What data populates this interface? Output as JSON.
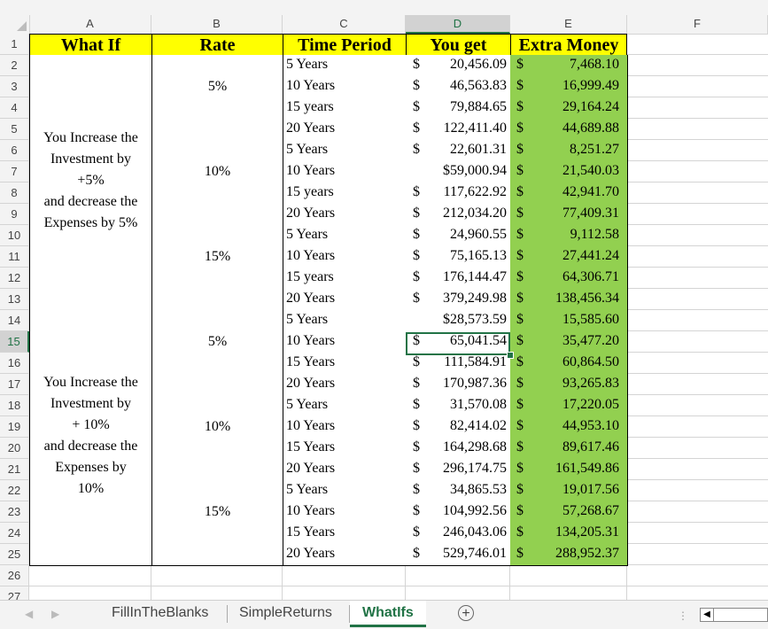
{
  "columns": [
    "A",
    "B",
    "C",
    "D",
    "E",
    "F"
  ],
  "rows": [
    "1",
    "2",
    "3",
    "4",
    "5",
    "6",
    "7",
    "8",
    "9",
    "10",
    "11",
    "12",
    "13",
    "14",
    "15",
    "16",
    "17",
    "18",
    "19",
    "20",
    "21",
    "22",
    "23",
    "24",
    "25",
    "26",
    "27"
  ],
  "selected_column": "D",
  "selected_row": "15",
  "headers": {
    "what_if": "What If",
    "rate": "Rate",
    "time_period": "Time Period",
    "you_get": "You get",
    "extra_money": "Extra Money"
  },
  "groups": [
    {
      "lines": [
        "You Increase the",
        "Investment by",
        "+5%",
        "and decrease the",
        "Expenses by 5%"
      ]
    },
    {
      "lines": [
        "You Increase the",
        "Investment by",
        "+ 10%",
        "and decrease the",
        "Expenses by",
        "10%"
      ]
    }
  ],
  "rates": [
    "5%",
    "10%",
    "15%",
    "5%",
    "10%",
    "15%"
  ],
  "data_rows": [
    {
      "period": "5 Years",
      "get": "20,456.09",
      "get_dollar": true,
      "extra": "7,468.10"
    },
    {
      "period": "10 Years",
      "get": "46,563.83",
      "get_dollar": true,
      "extra": "16,999.49"
    },
    {
      "period": "15 years",
      "get": "79,884.65",
      "get_dollar": true,
      "extra": "29,164.24"
    },
    {
      "period": "20 Years",
      "get": "122,411.40",
      "get_dollar": true,
      "extra": "44,689.88"
    },
    {
      "period": "5 Years",
      "get": "22,601.31",
      "get_dollar": true,
      "extra": "8,251.27"
    },
    {
      "period": "10 Years",
      "get": "$59,000.94",
      "get_dollar": false,
      "extra": "21,540.03"
    },
    {
      "period": "15 years",
      "get": "117,622.92",
      "get_dollar": true,
      "extra": "42,941.70"
    },
    {
      "period": "20 Years",
      "get": "212,034.20",
      "get_dollar": true,
      "extra": "77,409.31"
    },
    {
      "period": "5 Years",
      "get": "24,960.55",
      "get_dollar": true,
      "extra": "9,112.58"
    },
    {
      "period": "10 Years",
      "get": "75,165.13",
      "get_dollar": true,
      "extra": "27,441.24"
    },
    {
      "period": "15 years",
      "get": "176,144.47",
      "get_dollar": true,
      "extra": "64,306.71"
    },
    {
      "period": "20 Years",
      "get": "379,249.98",
      "get_dollar": true,
      "extra": "138,456.34"
    },
    {
      "period": "5 Years",
      "get": "$28,573.59",
      "get_dollar": false,
      "extra": "15,585.60"
    },
    {
      "period": "10 Years",
      "get": "65,041.54",
      "get_dollar": true,
      "extra": "35,477.20"
    },
    {
      "period": "15 Years",
      "get": "111,584.91",
      "get_dollar": true,
      "extra": "60,864.50"
    },
    {
      "period": "20 Years",
      "get": "170,987.36",
      "get_dollar": true,
      "extra": "93,265.83"
    },
    {
      "period": "5 Years",
      "get": "31,570.08",
      "get_dollar": true,
      "extra": "17,220.05"
    },
    {
      "period": "10 Years",
      "get": "82,414.02",
      "get_dollar": true,
      "extra": "44,953.10"
    },
    {
      "period": "15 Years",
      "get": "164,298.68",
      "get_dollar": true,
      "extra": "89,617.46"
    },
    {
      "period": "20 Years",
      "get": "296,174.75",
      "get_dollar": true,
      "extra": "161,549.86"
    },
    {
      "period": "5 Years",
      "get": "34,865.53",
      "get_dollar": true,
      "extra": "19,017.56"
    },
    {
      "period": "10 Years",
      "get": "104,992.56",
      "get_dollar": true,
      "extra": "57,268.67"
    },
    {
      "period": "15 Years",
      "get": "246,043.06",
      "get_dollar": true,
      "extra": "134,205.31"
    },
    {
      "period": "20 Years",
      "get": "529,746.01",
      "get_dollar": true,
      "extra": "288,952.37"
    }
  ],
  "currency_symbol": "$",
  "sheet_tabs": [
    {
      "label": "FillInTheBlanks",
      "active": false
    },
    {
      "label": "SimpleReturns",
      "active": false
    },
    {
      "label": "WhatIfs",
      "active": true
    }
  ],
  "colors": {
    "header_fill": "#ffff00",
    "extra_fill": "#92d050",
    "excel_green": "#217346"
  }
}
